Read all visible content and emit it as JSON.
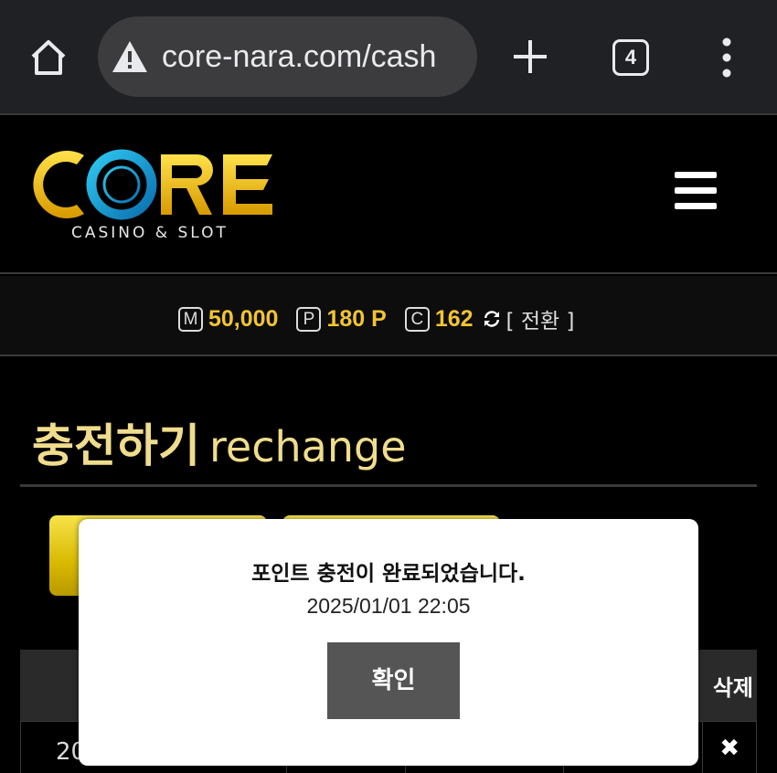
{
  "browser": {
    "url": "core-nara.com/cash",
    "tab_count": "4"
  },
  "site": {
    "logo_text": "CORE",
    "logo_subtitle": "CASINO & SLOT"
  },
  "balance": {
    "money_icon": "M",
    "money_value": "50,000",
    "point_icon": "P",
    "point_value": "180 P",
    "coin_icon": "C",
    "coin_value": "162",
    "convert_label": "[ 전환 ]"
  },
  "page": {
    "title_ko": "충전하기",
    "title_en": "rechange"
  },
  "table": {
    "delete_header": "삭제",
    "row_date_partial": "20",
    "delete_icon": "✖"
  },
  "dialog": {
    "message": "포인트 충전이 완료되었습니다.",
    "timestamp": "2025/01/01 22:05",
    "ok_label": "확인"
  },
  "colors": {
    "accent_gold": "#f2c530",
    "title_gold": "#f0dd8c",
    "button_yellow": "#d8b800",
    "logo_blue": "#1aa6d8"
  }
}
